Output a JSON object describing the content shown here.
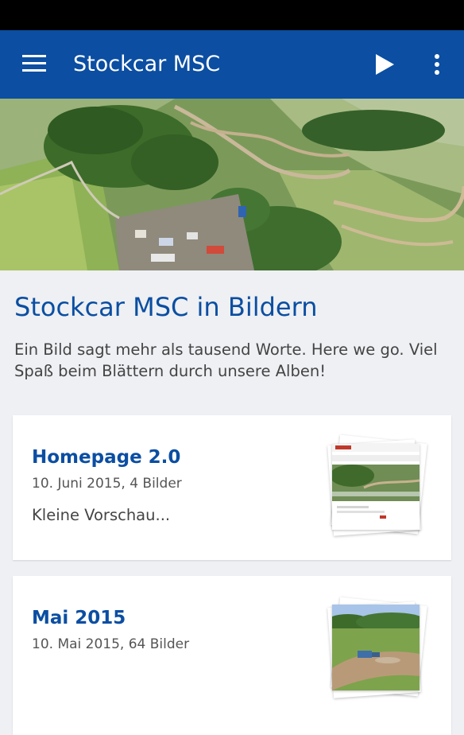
{
  "app_bar": {
    "title": "Stockcar MSC",
    "background": "#0b4ea2",
    "icons": [
      "menu-icon",
      "play-icon",
      "more-vert-icon"
    ]
  },
  "section": {
    "title": "Stockcar MSC in Bildern",
    "description": "Ein Bild sagt mehr als tausend Worte. Here we go. Viel Spaß beim Blättern durch unsere Alben!"
  },
  "albums": [
    {
      "title": "Homepage 2.0",
      "meta": "10. Juni 2015, 4 Bilder",
      "snippet": "Kleine Vorschau..."
    },
    {
      "title": "Mai 2015",
      "meta": "10. Mai 2015, 64 Bilder",
      "snippet": ""
    }
  ]
}
